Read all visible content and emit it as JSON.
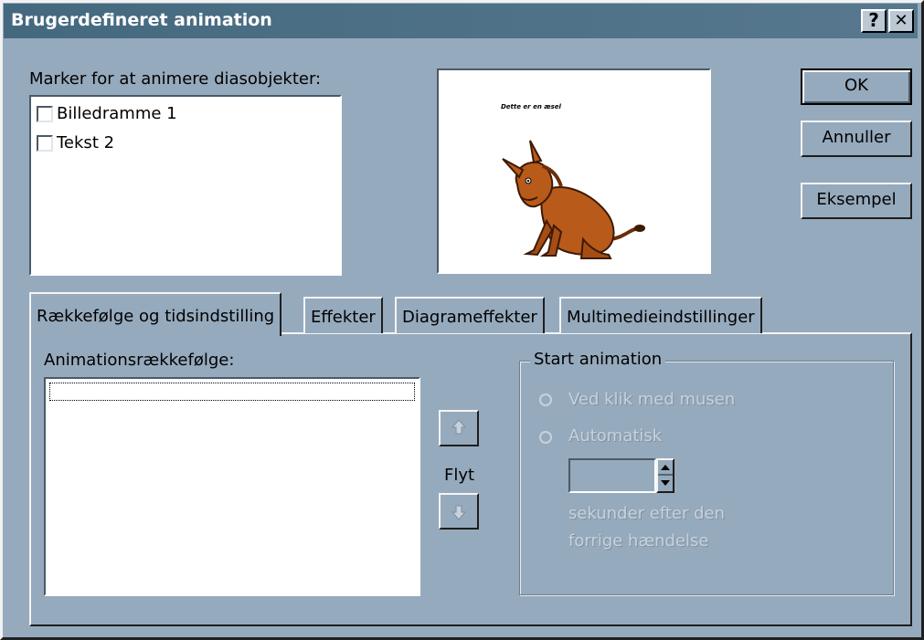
{
  "dialog": {
    "title": "Brugerdefineret animation",
    "help_button": "?",
    "close_button": "✕"
  },
  "objects": {
    "label": "Marker for at animere diasobjekter:",
    "items": [
      {
        "label": "Billedramme 1",
        "checked": false
      },
      {
        "label": "Tekst 2",
        "checked": false
      }
    ]
  },
  "preview": {
    "slide_text": "Dette er en æsel"
  },
  "buttons": {
    "ok": "OK",
    "cancel": "Annuller",
    "example": "Eksempel"
  },
  "tabs": [
    {
      "label": "Rækkefølge og tidsindstilling",
      "active": true
    },
    {
      "label": "Effekter",
      "active": false
    },
    {
      "label": "Diagrameffekter",
      "active": false
    },
    {
      "label": "Multimedieindstillinger",
      "active": false
    }
  ],
  "order": {
    "label": "Animationsrækkefølge:",
    "items": [],
    "move_label": "Flyt"
  },
  "start_animation": {
    "label": "Start animation",
    "on_click": "Ved klik med musen",
    "automatic": "Automatisk",
    "seconds_value": "",
    "after_line1": "sekunder efter den",
    "after_line2": "forrige hændelse",
    "enabled": false
  },
  "colors": {
    "dialog_bg": "#96aabd",
    "title_bar": "#44697f",
    "animal": "#b85a1a"
  }
}
